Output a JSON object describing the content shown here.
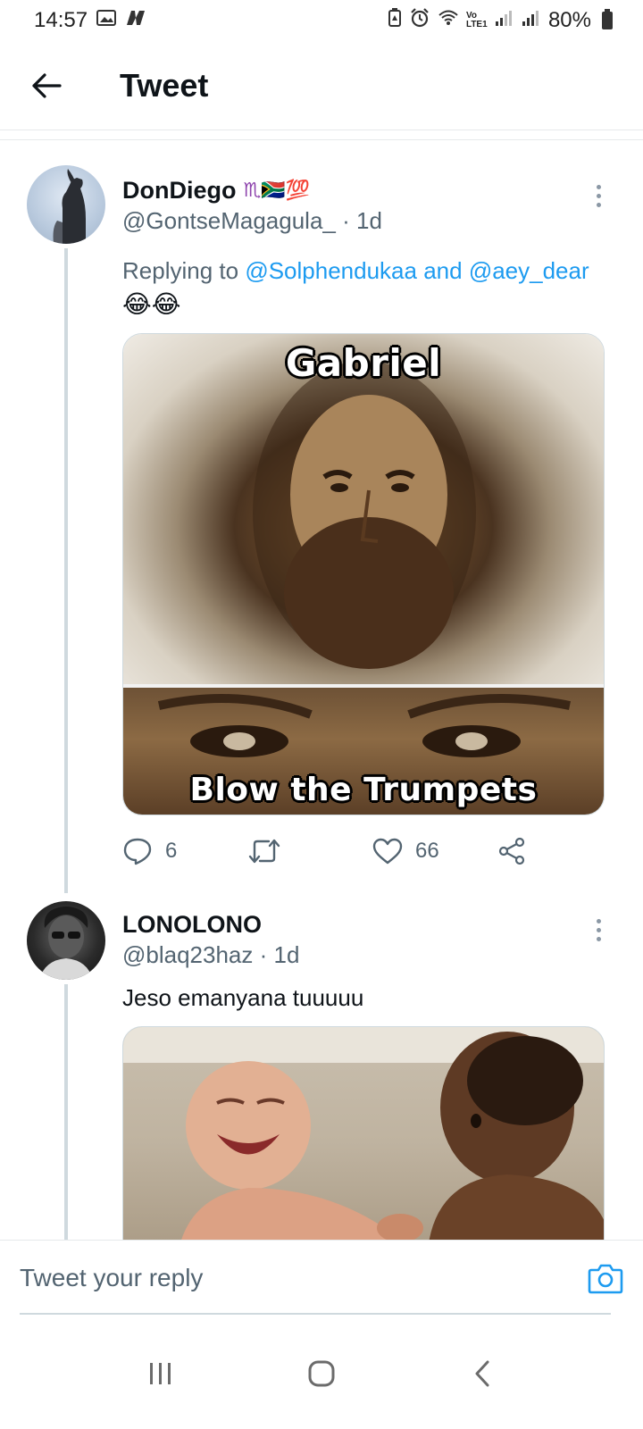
{
  "status_bar": {
    "time": "14:57",
    "network_label": "Vo LTE1",
    "battery": "80%"
  },
  "header": {
    "title": "Tweet"
  },
  "tweets": [
    {
      "name": "DonDiego",
      "name_emoji": "♏🇿🇦💯",
      "handle": "@GontseMagagula_",
      "time": "· 1d",
      "replying_prefix": "Replying to",
      "mention_1": "@Solphendukaa",
      "mention_joiner": "and",
      "mention_2": "@aey_dear",
      "text": "😂😂",
      "media": {
        "caption_top": "Gabriel",
        "caption_bottom": "Blow the Trumpets"
      },
      "replies_count": "6",
      "retweets_count": "",
      "likes_count": "66"
    },
    {
      "name": "LONOLONO",
      "handle": "@blaq23haz",
      "time": "· 1d",
      "text": "Jeso emanyana tuuuuu"
    }
  ],
  "reply_bar": {
    "placeholder": "Tweet your reply"
  },
  "colors": {
    "accent": "#1d9bf0",
    "secondary_text": "#536471",
    "primary_text": "#0f1419",
    "thread_line": "#cfd9de"
  }
}
